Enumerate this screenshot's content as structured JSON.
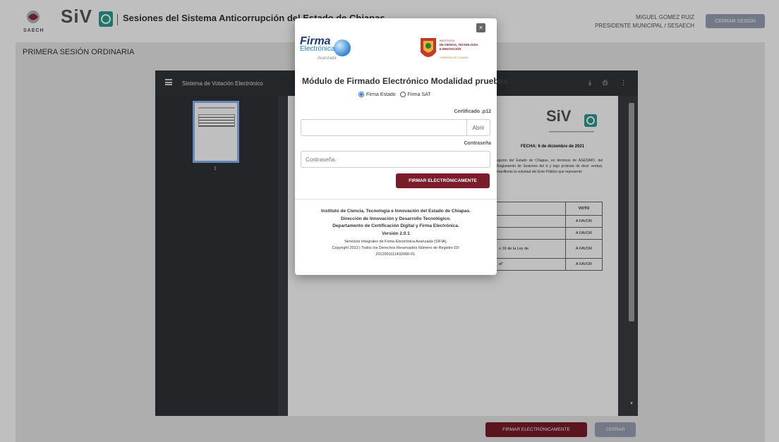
{
  "header": {
    "title": "Sesiones del Sistema Anticorrupción del Estado de Chiapas",
    "sesaech_logo_text": "SAECH",
    "siv_logo_text": "SiV",
    "user_name": "MIGUEL GOMEZ RUIZ",
    "user_role": "PRESIDENTE MUNICIPAL / SESAECH",
    "logout_label": "CERRAR SESIÓN"
  },
  "session": {
    "title": "PRIMERA SESIÓN ORDINARIA"
  },
  "viewer": {
    "title": "Sistema de Votación Electrónico",
    "page_number": "1",
    "doc": {
      "siv_text": "SiV",
      "fecha": "FECHA: 6 de diciembre de 2021",
      "paragraph": "upción del Estado de Chiapas, en términos de AGÉSIMO, del Reglamento de Sesiones del d y bajo protesta de decir verdad, manifiesto la voluntad del Ente Público que represento",
      "table_header": "VOTO",
      "rows": [
        {
          "text": "",
          "vote": "A FAVOR"
        },
        {
          "text": "",
          "vote": "A FAVOR"
        },
        {
          "text": "o 16 de la Ley de",
          "vote": "A FAVOR"
        },
        {
          "text": "el\"",
          "vote": "A FAVOR"
        }
      ]
    }
  },
  "actions": {
    "sign_label": "FIRMAR ELECTRÓNICAMENTE",
    "close_label": "CERRAR"
  },
  "modal": {
    "close_glyph": "×",
    "firma_logo": "Firma",
    "electronica_logo": "Electrónica",
    "avanzada_logo": "Avanzada",
    "institute_logo_l1": "INSTITUTO",
    "institute_logo_l2": "DE CIENCIA, TECNOLOGÍA",
    "institute_logo_l3": "E INNOVACIÓN",
    "institute_logo_l4": "GOBIERNO DE CHIAPAS",
    "heading": "Módulo de Firmado Electrónico  Modalidad pruebas",
    "radio_estado": "Firma Estado",
    "radio_sat": "Firma SAT",
    "cert_label": "Certificado .p12",
    "open_label": "Abrir",
    "password_label": "Contraseña",
    "password_placeholder": "Contraseña.",
    "sign_label": "FIRMAR ELECTRÓNICAMENTE",
    "footer_l1": "Instituto de Ciencia, Tecnología e Innovación del Estado de Chiapas.",
    "footer_l2": "Dirección de Innovación y Desarrollo Tecnológico.",
    "footer_l3": "Departamento de Certificación Digital y Firma Electrónica.",
    "footer_l4": "Versión 2.0.1",
    "footer_l5": "Servicios Integrales de Firma Electrónica Avanzada (SIFIA).",
    "footer_l6": "Copyright 2012 | Todos los Derechos Reservados Número de Registro 03-",
    "footer_l7": "2012091111432000-01."
  },
  "colors": {
    "accent": "#7a1c2a",
    "secondary_button": "#9aa2b3",
    "siv_teal": "#2a9d8f"
  }
}
